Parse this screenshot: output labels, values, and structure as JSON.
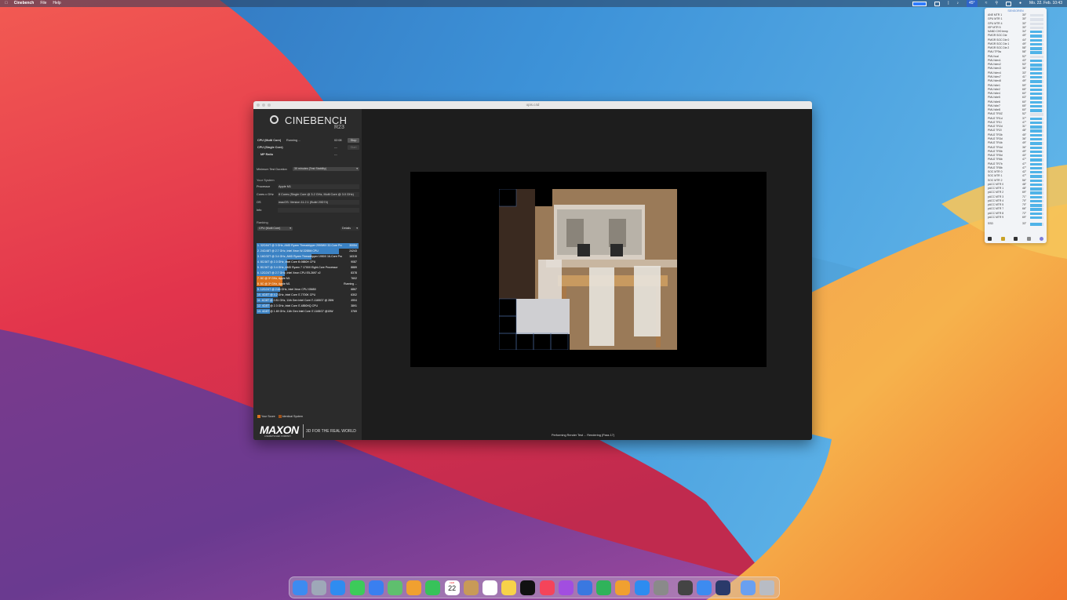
{
  "menubar": {
    "app_name": "Cinebench",
    "menu_items": [
      "File",
      "Help"
    ],
    "temp_label": "45°",
    "clock": "Mo. 22. Feb. 10:43"
  },
  "sensor_panel": {
    "header": "SENSOREN",
    "sensors": [
      {
        "name": "ANE MTR 1",
        "value": "30°",
        "level": 0
      },
      {
        "name": "GPU MTR 1",
        "value": "30°",
        "level": 0
      },
      {
        "name": "GPU MTR 4",
        "value": "30°",
        "level": 0
      },
      {
        "name": "ISP MTR 5",
        "value": "30°",
        "level": 0
      },
      {
        "name": "NAND CH0 temp",
        "value": "34°",
        "level": 0.9
      },
      {
        "name": "PMGR SOC Die",
        "value": "49°",
        "level": 0.9
      },
      {
        "name": "PMGR SOC Die 0",
        "value": "44°",
        "level": 0.9
      },
      {
        "name": "PMGR SOC Die 1",
        "value": "49°",
        "level": 0.9
      },
      {
        "name": "PMGR SOC Die 2",
        "value": "58°",
        "level": 0.9
      },
      {
        "name": "PMU TP3w",
        "value": "58°",
        "level": 0.9
      },
      {
        "name": "PMU tcal",
        "value": "52°",
        "level": 0
      },
      {
        "name": "PMU tdev1",
        "value": "43°",
        "level": 0.9
      },
      {
        "name": "PMU tdev2",
        "value": "53°",
        "level": 0.9
      },
      {
        "name": "PMU tdev3",
        "value": "36°",
        "level": 0.9
      },
      {
        "name": "PMU tdev4",
        "value": "33°",
        "level": 0.9
      },
      {
        "name": "PMU tdev7",
        "value": "41°",
        "level": 0.9
      },
      {
        "name": "PMU tdev8",
        "value": "49°",
        "level": 0.9
      },
      {
        "name": "PMU tdie1",
        "value": "59°",
        "level": 0.9
      },
      {
        "name": "PMU tdie2",
        "value": "65°",
        "level": 0.9
      },
      {
        "name": "PMU tdie4",
        "value": "60°",
        "level": 0.9
      },
      {
        "name": "PMU tdie5",
        "value": "63°",
        "level": 0.9
      },
      {
        "name": "PMU tdie6",
        "value": "60°",
        "level": 0.9
      },
      {
        "name": "PMU tdie7",
        "value": "65°",
        "level": 0.9
      },
      {
        "name": "PMU tdie8",
        "value": "60°",
        "level": 0.9
      },
      {
        "name": "PMU2 TR0Z",
        "value": "52°",
        "level": 0
      },
      {
        "name": "PMU2 TR1d",
        "value": "37°",
        "level": 0.9
      },
      {
        "name": "PMU2 TR1l",
        "value": "47°",
        "level": 0.9
      },
      {
        "name": "PMU2 TR2d",
        "value": "31°",
        "level": 0.9
      },
      {
        "name": "PMU2 TR2l",
        "value": "48°",
        "level": 0.9
      },
      {
        "name": "PMU2 TR3b",
        "value": "45°",
        "level": 0.9
      },
      {
        "name": "PMU2 TR3d",
        "value": "36°",
        "level": 0.9
      },
      {
        "name": "PMU2 TR4b",
        "value": "49°",
        "level": 0.9
      },
      {
        "name": "PMU2 TR4d",
        "value": "36°",
        "level": 0.9
      },
      {
        "name": "PMU2 TR5b",
        "value": "49°",
        "level": 0.9
      },
      {
        "name": "PMU2 TR5d",
        "value": "40°",
        "level": 0.9
      },
      {
        "name": "PMU2 TR6b",
        "value": "47°",
        "level": 0.9
      },
      {
        "name": "PMU2 TR7b",
        "value": "47°",
        "level": 0.9
      },
      {
        "name": "PMU2 TR8b",
        "value": "47°",
        "level": 0.9
      },
      {
        "name": "SOC MTR 0",
        "value": "42°",
        "level": 0.9
      },
      {
        "name": "SOC MTR 1",
        "value": "47°",
        "level": 0.9
      },
      {
        "name": "SOC MTR 2",
        "value": "56°",
        "level": 0.9
      },
      {
        "name": "pACC MTR 0",
        "value": "48°",
        "level": 0.9
      },
      {
        "name": "pACC MTR 1",
        "value": "48°",
        "level": 0.9
      },
      {
        "name": "pACC MTR 2",
        "value": "69°",
        "level": 0.9
      },
      {
        "name": "pACC MTR 3",
        "value": "71°",
        "level": 0.9
      },
      {
        "name": "pACC MTR 4",
        "value": "70°",
        "level": 0.9
      },
      {
        "name": "pACC MTR 5",
        "value": "70°",
        "level": 0.9
      },
      {
        "name": "pACC MTR 7",
        "value": "66°",
        "level": 0.9
      },
      {
        "name": "pACC MTR 8",
        "value": "72°",
        "level": 0.9
      },
      {
        "name": "pACC MTR 9",
        "value": "69°",
        "level": 0.9
      }
    ],
    "ssd": {
      "name": "SSD",
      "value": "33°",
      "level": 0.9
    }
  },
  "window": {
    "title": "opis.c4d",
    "logo_text": "CINEBENCH",
    "logo_version": "R23",
    "tests": [
      {
        "label": "CPU (Multi Core)",
        "status": "Running ...",
        "time": "02:08",
        "button": "Stop"
      },
      {
        "label": "CPU (Single Core)",
        "status": "",
        "time": "---",
        "button": "Start"
      },
      {
        "label": "MP Ratio",
        "status": "",
        "time": "---",
        "button": ""
      }
    ],
    "min_duration_label": "Minimum Test Duration",
    "min_duration_value": "30 minutes (Test Stability)",
    "your_system": "Your System",
    "system_info": [
      {
        "key": "Processor",
        "value": "Apple M1"
      },
      {
        "key": "Cores x GHz",
        "value": "8 Cores (Single Core @ 3.2 GHz, Multi Core @ 3.0 GHz)"
      },
      {
        "key": "OS",
        "value": "macOS: Version 11.2.1 (Build 20D74)"
      },
      {
        "key": "Info",
        "value": ""
      }
    ],
    "ranking_label": "Ranking",
    "ranking_dropdown": "CPU (Multi Core)",
    "details_label": "Details",
    "ranking": [
      {
        "text": "1. 32C/64T @ 3 GHz, AMD Ryzen Threadripper 2990WX 32-Core Processor",
        "score": "30054",
        "color": "#3b82c4",
        "fill": 1.0
      },
      {
        "text": "2. 24C/48T @ 2.7 GHz, Intel Xeon W-3265M CPU",
        "score": "24243",
        "color": "#3b82c4",
        "fill": 0.81
      },
      {
        "text": "3. 16C/32T @ 3.4 GHz, AMD Ryzen Threadripper 1950X 16-Core Processor",
        "score": "16315",
        "color": "#3b82c4",
        "fill": 0.54
      },
      {
        "text": "4. 8C/16T @ 2.3 GHz, Intel Core i9-9880H CPU",
        "score": "9087",
        "color": "#3b82c4",
        "fill": 0.3
      },
      {
        "text": "5. 8C/16T @ 3.4 GHz, AMD Ryzen 7 1700X Eight-Core Processor",
        "score": "8889",
        "color": "#3b82c4",
        "fill": 0.3
      },
      {
        "text": "6. 12C/24T @ 2.7 GHz, Intel Xeon CPU E5-2697 v2",
        "score": "8378",
        "color": "#3b82c4",
        "fill": 0.28
      },
      {
        "text": "7. 8C @ 3* GHz, Apple M1",
        "score": "7602",
        "color": "#d9731e",
        "fill": 0.25
      },
      {
        "text": "8. 8C @ 3* GHz, Apple M1",
        "score": "Running ...",
        "color": "#d9731e",
        "fill": 0.25
      },
      {
        "text": "9. 12C/24T @ 2.66 GHz, Intel Xeon CPU X5650",
        "score": "6867",
        "color": "#3b82c4",
        "fill": 0.23
      },
      {
        "text": "10. 4C/8T @ 4.2 GHz, Intel Core i7-7700K CPU",
        "score": "6302",
        "color": "#3b82c4",
        "fill": 0.21
      },
      {
        "text": "11. 4C/8T @ 2.81 GHz, 11th Gen Intel Core i7-1165G7 @ 28W",
        "score": "4904",
        "color": "#3b82c4",
        "fill": 0.16
      },
      {
        "text": "12. 4C/8T @ 2.3 GHz, Intel Core i7-4850HQ CPU",
        "score": "3891",
        "color": "#3b82c4",
        "fill": 0.13
      },
      {
        "text": "13. 4C/8T @ 1.69 GHz, 11th Gen Intel Core i7-1165G7 @15W",
        "score": "3769",
        "color": "#3b82c4",
        "fill": 0.13
      }
    ],
    "legend_your_score": "Your Score",
    "legend_identical": "Identical System",
    "maxon_logo": "MAXON",
    "maxon_sub": "A NEMETSCHEK COMPANY",
    "tagline": "3D FOR THE REAL WORLD",
    "status_text": "Performing Render Test ... Rendering (Pass 17)"
  },
  "dock": {
    "apps": [
      "finder-icon",
      "launchpad-icon",
      "safari-icon",
      "messages-icon",
      "mail-icon",
      "maps-icon",
      "photos-icon",
      "facetime-icon",
      "calendar-icon",
      "contacts-icon",
      "reminders-icon",
      "notes-icon",
      "apple-tv-icon",
      "music-icon",
      "podcasts-icon",
      "keynote-icon",
      "numbers-icon",
      "pages-icon",
      "app-store-icon",
      "system-preferences-icon",
      "final-cut-icon",
      "safari-alt-icon",
      "cinebench-icon",
      "finder-folder-icon",
      "trash-icon"
    ],
    "calendar_month": "FEB",
    "calendar_day": "22"
  }
}
